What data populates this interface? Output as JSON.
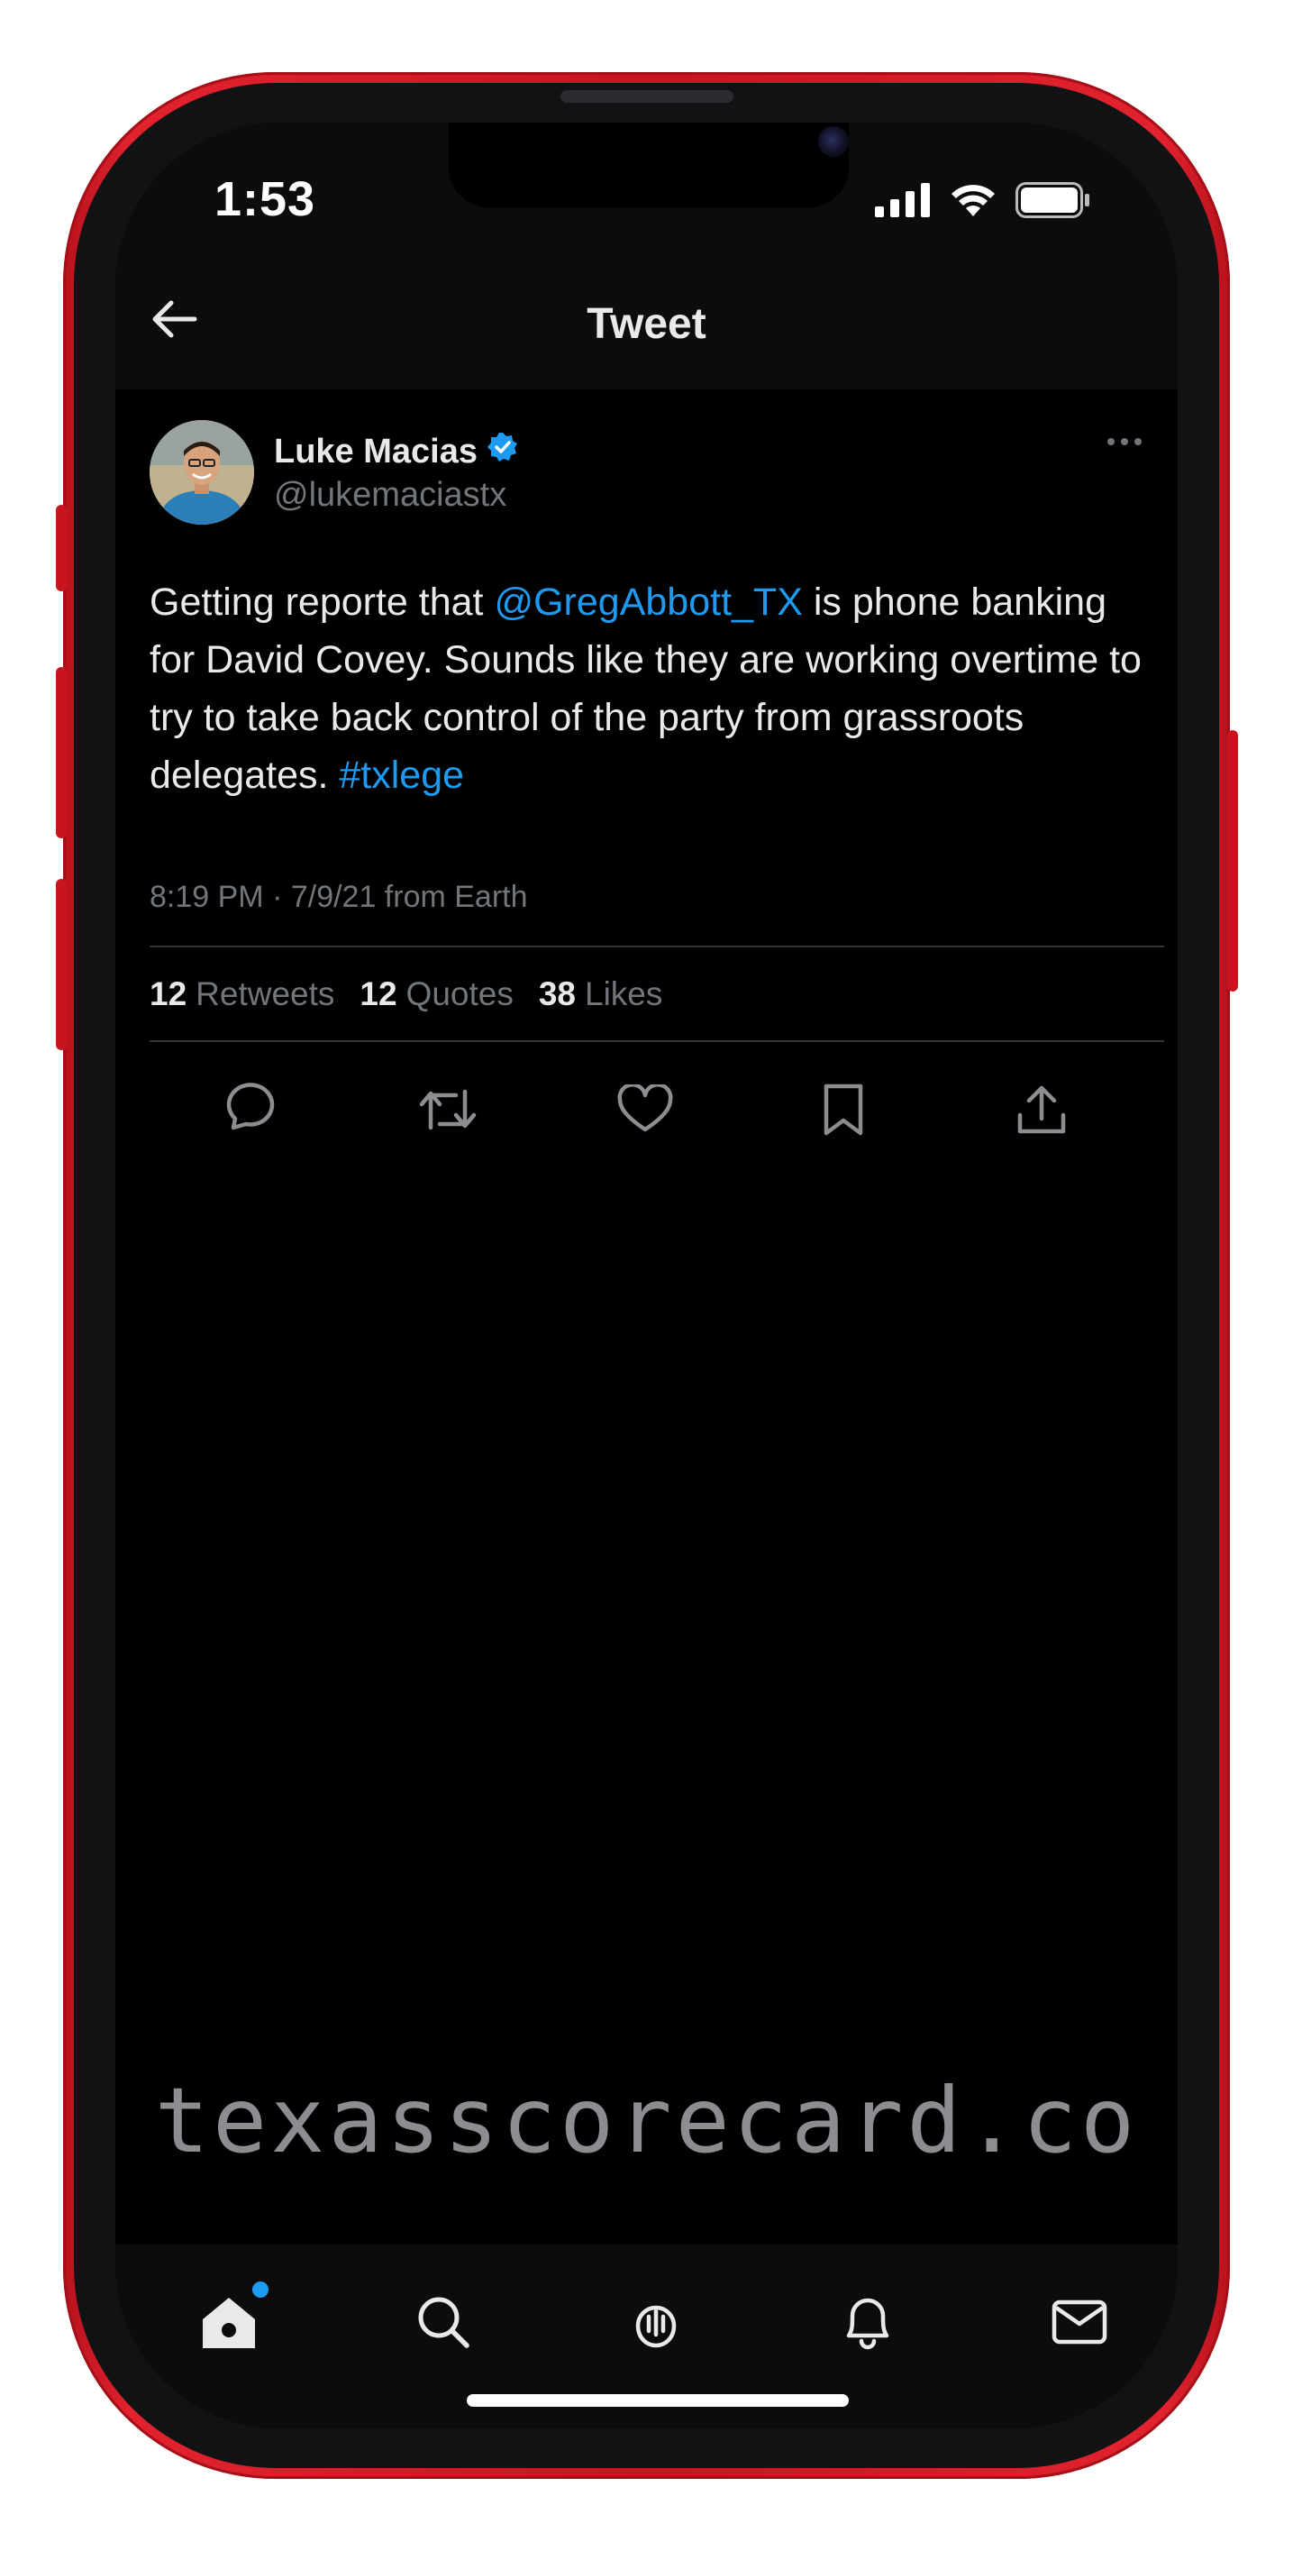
{
  "status_bar": {
    "time": "1:53"
  },
  "nav": {
    "title": "Tweet"
  },
  "tweet": {
    "author": {
      "name": "Luke Macias",
      "handle": "@lukemaciastx",
      "verified": true
    },
    "text": {
      "part1": "Getting reporte that ",
      "mention": "@GregAbbott_TX",
      "part2": " is phone banking for David Covey. Sounds like they are working overtime to try to take back control of the party from grassroots delegates. ",
      "hashtag": "#txlege"
    },
    "meta": "8:19 PM · 7/9/21 from Earth",
    "stats": {
      "retweets_count": "12",
      "retweets_label": "Retweets",
      "quotes_count": "12",
      "quotes_label": "Quotes",
      "likes_count": "38",
      "likes_label": "Likes"
    }
  },
  "watermark": "texasscorecard.co",
  "colors": {
    "accent": "#1d9bf0",
    "phone_body": "#d71e28",
    "background": "#000000"
  },
  "icons": {
    "actions": [
      "reply-icon",
      "retweet-icon",
      "like-icon",
      "bookmark-icon",
      "share-icon"
    ],
    "tabs": [
      "home-icon",
      "search-icon",
      "spaces-icon",
      "notifications-icon",
      "messages-icon"
    ]
  }
}
